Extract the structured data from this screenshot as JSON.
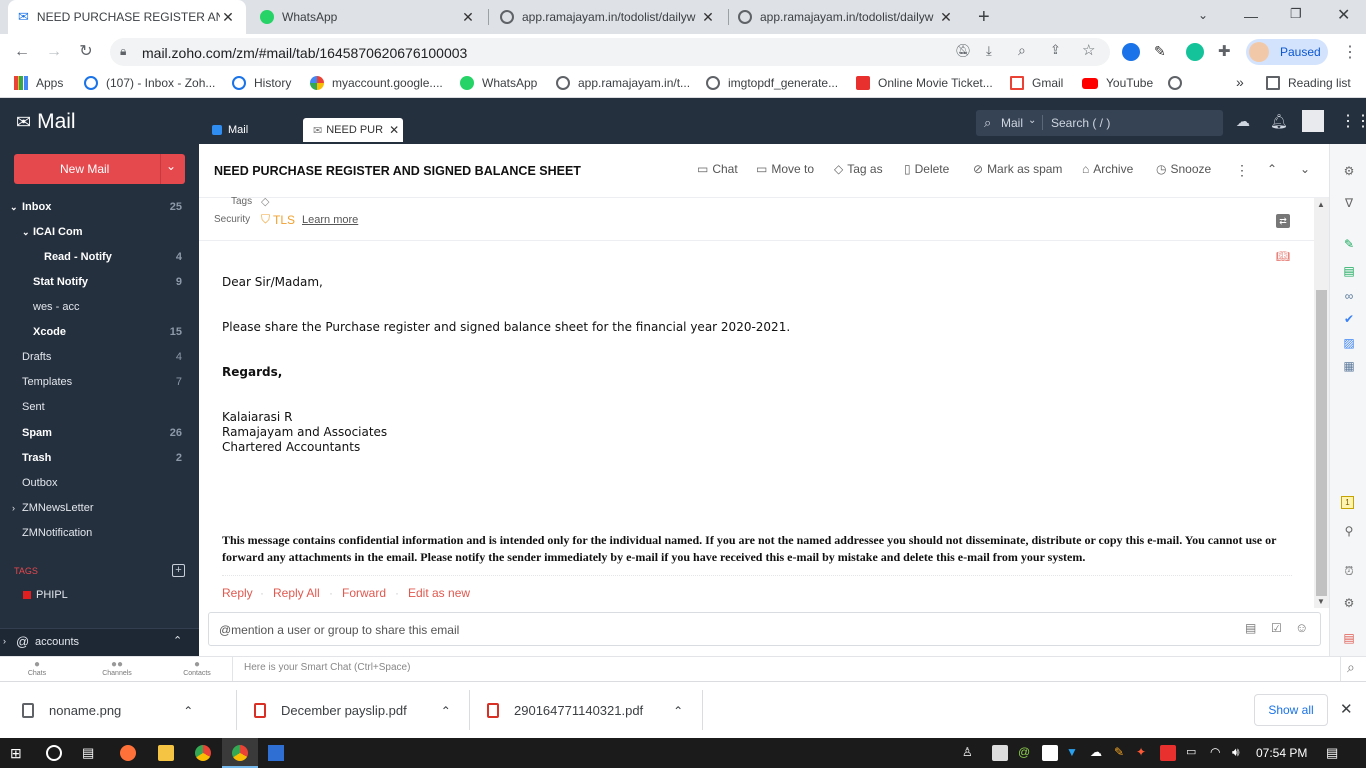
{
  "browser": {
    "tabs": [
      {
        "title": "NEED PURCHASE REGISTER AND",
        "icon": "zoho-mail-icon",
        "active": true
      },
      {
        "title": "WhatsApp",
        "icon": "whatsapp-icon",
        "active": false
      },
      {
        "title": "app.ramajayam.in/todolist/dailyw",
        "icon": "globe-icon",
        "active": false
      },
      {
        "title": "app.ramajayam.in/todolist/dailyw",
        "icon": "globe-icon",
        "active": false
      }
    ],
    "url": "mail.zoho.com/zm/#mail/tab/1645870620676100003",
    "profile_status": "Paused",
    "bookmarks": [
      "Apps",
      "(107) - Inbox - Zoh...",
      "History",
      "myaccount.google....",
      "WhatsApp",
      "app.ramajayam.in/t...",
      "imgtopdf_generate...",
      "Online Movie Ticket...",
      "Gmail",
      "YouTube"
    ],
    "reading_list": "Reading list",
    "more_bookmarks": "»"
  },
  "zoho": {
    "app_name": "Mail",
    "tabs": [
      {
        "label": "Mail"
      },
      {
        "label": "NEED PUR"
      }
    ],
    "search": {
      "scope": "Mail",
      "placeholder": "Search ( / )"
    }
  },
  "sidebar": {
    "new_mail": "New Mail",
    "folders": [
      {
        "name": "Inbox",
        "count": "25",
        "bold": true,
        "level": 0
      },
      {
        "name": "ICAI Com",
        "count": "",
        "bold": true,
        "level": 1
      },
      {
        "name": "Read - Notify",
        "count": "4",
        "bold": true,
        "level": 2
      },
      {
        "name": "Stat Notify",
        "count": "9",
        "bold": true,
        "level": 1
      },
      {
        "name": "wes - acc",
        "count": "",
        "bold": false,
        "level": 1
      },
      {
        "name": "Xcode",
        "count": "15",
        "bold": true,
        "level": 1
      },
      {
        "name": "Drafts",
        "count": "4",
        "bold": false,
        "level": 0
      },
      {
        "name": "Templates",
        "count": "7",
        "bold": false,
        "level": 0
      },
      {
        "name": "Sent",
        "count": "",
        "bold": false,
        "level": 0
      },
      {
        "name": "Spam",
        "count": "26",
        "bold": true,
        "level": 0
      },
      {
        "name": "Trash",
        "count": "2",
        "bold": true,
        "level": 0
      },
      {
        "name": "Outbox",
        "count": "",
        "bold": false,
        "level": 0
      },
      {
        "name": "ZMNewsLetter",
        "count": "",
        "bold": false,
        "level": 0
      },
      {
        "name": "ZMNotification",
        "count": "",
        "bold": false,
        "level": 0
      }
    ],
    "tags_heading": "TAGS",
    "tags": [
      {
        "name": "PHIPL",
        "color": "#e02020"
      }
    ],
    "account": "accounts"
  },
  "mail": {
    "subject": "NEED PURCHASE REGISTER AND SIGNED BALANCE SHEET",
    "actions": [
      "Chat",
      "Move to",
      "Tag as",
      "Delete",
      "Mark as spam",
      "Archive",
      "Snooze"
    ],
    "tags_label": "Tags",
    "security_label": "Security",
    "tls": "TLS",
    "learn_more": "Learn more",
    "greeting": "Dear Sir/Madam,",
    "body": "Please share the Purchase register and signed balance sheet for the financial year 2020-2021.",
    "regards": "Regards,",
    "signature": [
      "Kalaiarasi R",
      "Ramajayam and Associates",
      "Chartered Accountants"
    ],
    "disclaimer": "This message contains confidential information and is intended only for the individual named. If you are not the named addressee you should not disseminate, distribute or copy this e-mail. You cannot use or forward any attachments in the email. Please notify the sender immediately by e-mail if you have received this e-mail by mistake and delete this e-mail from your system.",
    "reply_actions": [
      "Reply",
      "Reply All",
      "Forward",
      "Edit as new"
    ],
    "mention_placeholder": "@mention a user or group to share this email"
  },
  "chatbar": {
    "items": [
      "Chats",
      "Channels",
      "Contacts"
    ],
    "smart_chat": "Here is your Smart Chat (Ctrl+Space)"
  },
  "downloads": {
    "files": [
      "noname.png",
      "December payslip.pdf",
      "290164771140321.pdf"
    ],
    "show_all": "Show all"
  },
  "taskbar": {
    "time": "07:54 PM"
  },
  "colors": {
    "zoho_dark": "#25303f",
    "new_mail_red": "#e5484d",
    "link_red": "#e0594f",
    "tls_orange": "#f0a030"
  }
}
